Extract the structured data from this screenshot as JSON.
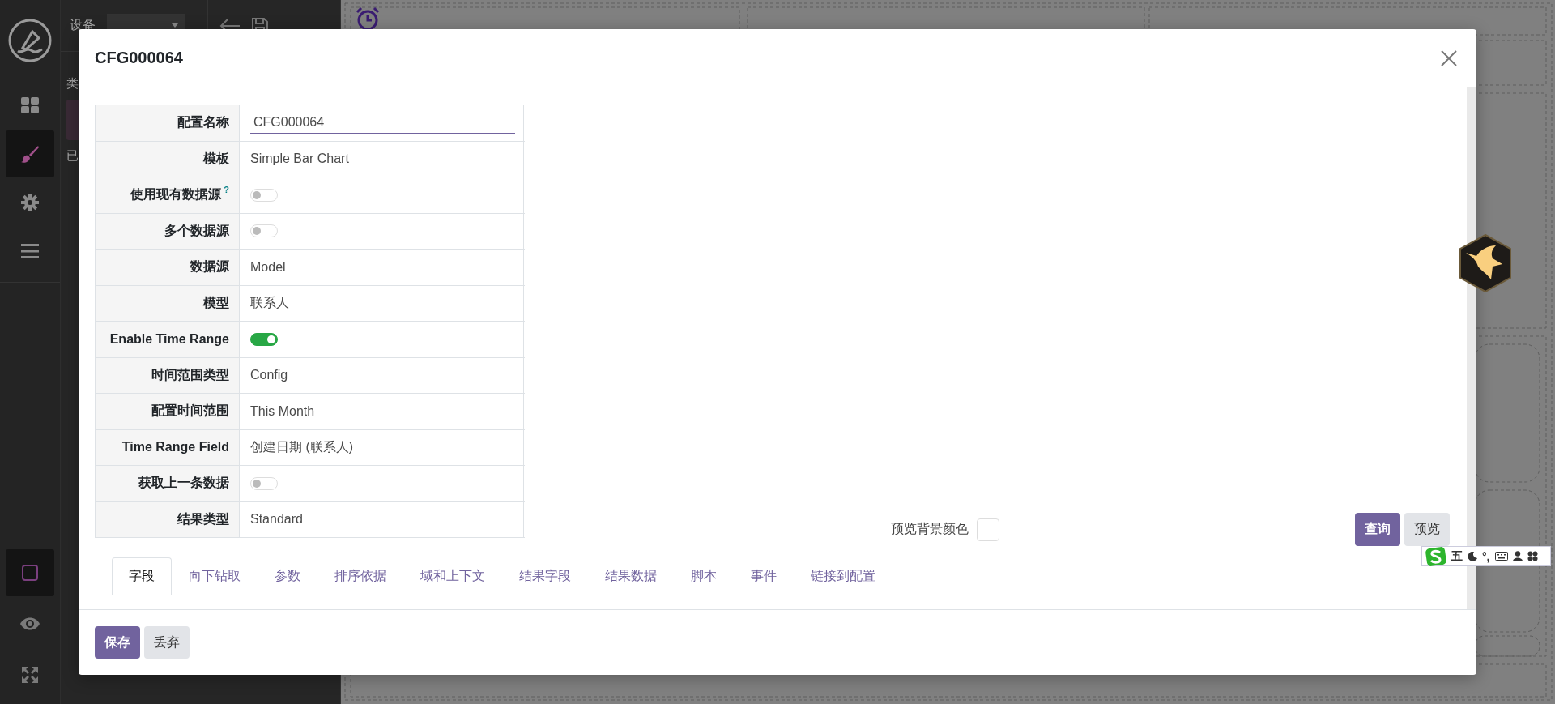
{
  "sidebar": {
    "top_items": [
      {
        "kind": "grid",
        "selected": false
      },
      {
        "kind": "brush",
        "selected": true
      },
      {
        "kind": "gear",
        "selected": false
      },
      {
        "kind": "menu",
        "selected": false
      }
    ],
    "bottom_items": [
      {
        "kind": "square",
        "selected": true
      },
      {
        "kind": "eye",
        "selected": false
      },
      {
        "kind": "expand",
        "selected": false
      }
    ]
  },
  "panel": {
    "device_label": "设备",
    "texts": [
      "类",
      "已"
    ]
  },
  "dialog": {
    "title": "CFG000064",
    "fields": [
      {
        "label": "配置名称",
        "kind": "input",
        "value": "CFG000064"
      },
      {
        "label": "模板",
        "kind": "text",
        "value": "Simple Bar Chart"
      },
      {
        "label": "使用现有数据源",
        "help": "?",
        "kind": "toggle",
        "on": false
      },
      {
        "label": "多个数据源",
        "kind": "toggle",
        "on": false
      },
      {
        "label": "数据源",
        "kind": "text",
        "value": "Model"
      },
      {
        "label": "模型",
        "kind": "text",
        "value": "联系人"
      },
      {
        "label": "Enable Time Range",
        "kind": "toggle",
        "on": true
      },
      {
        "label": "时间范围类型",
        "kind": "text",
        "value": "Config"
      },
      {
        "label": "配置时间范围",
        "kind": "text",
        "value": "This Month"
      },
      {
        "label": "Time Range Field",
        "kind": "text",
        "value": "创建日期 (联系人)"
      },
      {
        "label": "获取上一条数据",
        "kind": "toggle",
        "on": false
      },
      {
        "label": "结果类型",
        "kind": "text",
        "value": "Standard"
      }
    ],
    "preview_bg_label": "预览背景颜色",
    "actions": [
      {
        "label": "查询",
        "primary": true
      },
      {
        "label": "预览",
        "primary": false
      }
    ],
    "tabs": [
      {
        "label": "字段",
        "selected": true
      },
      {
        "label": "向下钻取",
        "selected": false
      },
      {
        "label": "参数",
        "selected": false
      },
      {
        "label": "排序依据",
        "selected": false
      },
      {
        "label": "域和上下文",
        "selected": false
      },
      {
        "label": "结果字段",
        "selected": false
      },
      {
        "label": "结果数据",
        "selected": false
      },
      {
        "label": "脚本",
        "selected": false
      },
      {
        "label": "事件",
        "selected": false
      },
      {
        "label": "链接到配置",
        "selected": false
      }
    ],
    "footer_buttons": [
      {
        "label": "保存",
        "primary": true
      },
      {
        "label": "丢弃",
        "primary": false
      }
    ]
  },
  "ime_bar": {
    "mode": "五",
    "punctuation": "°,"
  }
}
